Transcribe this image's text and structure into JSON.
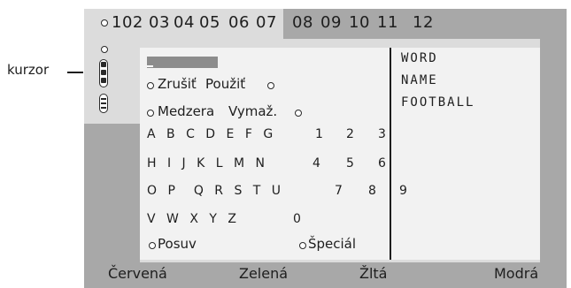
{
  "pages": [
    "102",
    "03",
    "04",
    "05",
    "06",
    "07",
    "08",
    "09",
    "10",
    "11",
    "12"
  ],
  "callout": {
    "label": "kurzor"
  },
  "buttons": {
    "cancel": "Zrušiť",
    "use": "Použiť",
    "space": "Medzera",
    "delete": "Vymaž.",
    "shift": "Posuv",
    "special": "Špeciál"
  },
  "keyboard": {
    "row1": {
      "letters": "A B C D E F G",
      "d1": "1",
      "d2": "2",
      "d3": "3"
    },
    "row2": {
      "letters": "H I J K L M N",
      "d1": "4",
      "d2": "5",
      "d3": "6"
    },
    "row3": {
      "letters": "O P  Q R S T U",
      "d2": "7",
      "d3": "8",
      "extra": "9"
    },
    "row4": {
      "letters": "V W X Y Z",
      "d2": "0"
    }
  },
  "word_list": [
    "WORD",
    "NAME",
    "FOOTBALL"
  ],
  "color_keys": {
    "red": "Červená",
    "green": "Zelená",
    "yellow": "Žltá",
    "blue": "Modrá"
  }
}
